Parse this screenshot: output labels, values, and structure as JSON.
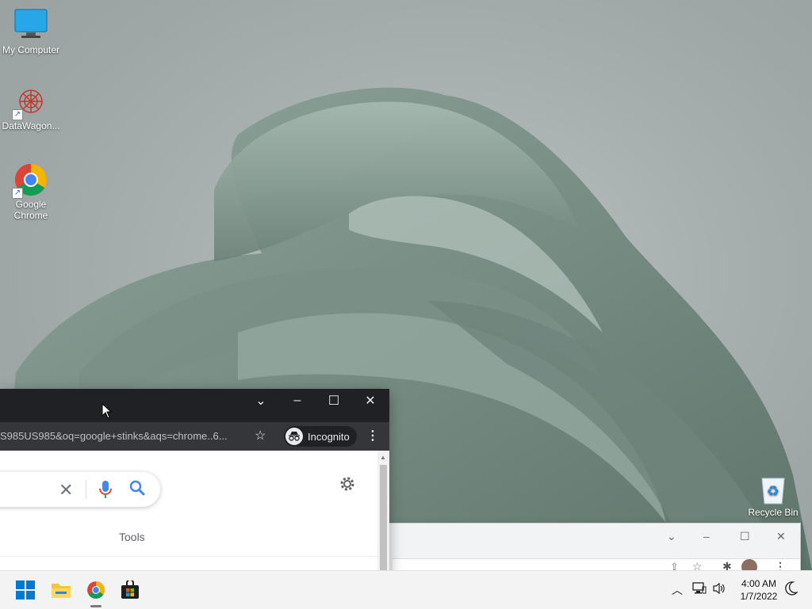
{
  "desktop": {
    "icons": [
      {
        "label": "My Computer",
        "icon": "monitor-icon"
      },
      {
        "label": "DataWagon...",
        "icon": "datawagon-app-icon"
      },
      {
        "label": "Google Chrome",
        "icon": "chrome-icon"
      },
      {
        "label": "Recycle Bin",
        "icon": "recycle-bin-icon"
      }
    ]
  },
  "browser": {
    "url": "S985US985&oq=google+stinks&aqs=chrome..6...",
    "incognito_label": "Incognito",
    "tools_label": "Tools",
    "theme_color": "#202124",
    "toolbar_color": "#35363a"
  },
  "taskbar": {
    "apps": [
      "windows-start-icon",
      "file-explorer-icon",
      "chrome-icon",
      "microsoft-store-icon"
    ],
    "time": "4:00 AM",
    "date": "1/7/2022"
  }
}
